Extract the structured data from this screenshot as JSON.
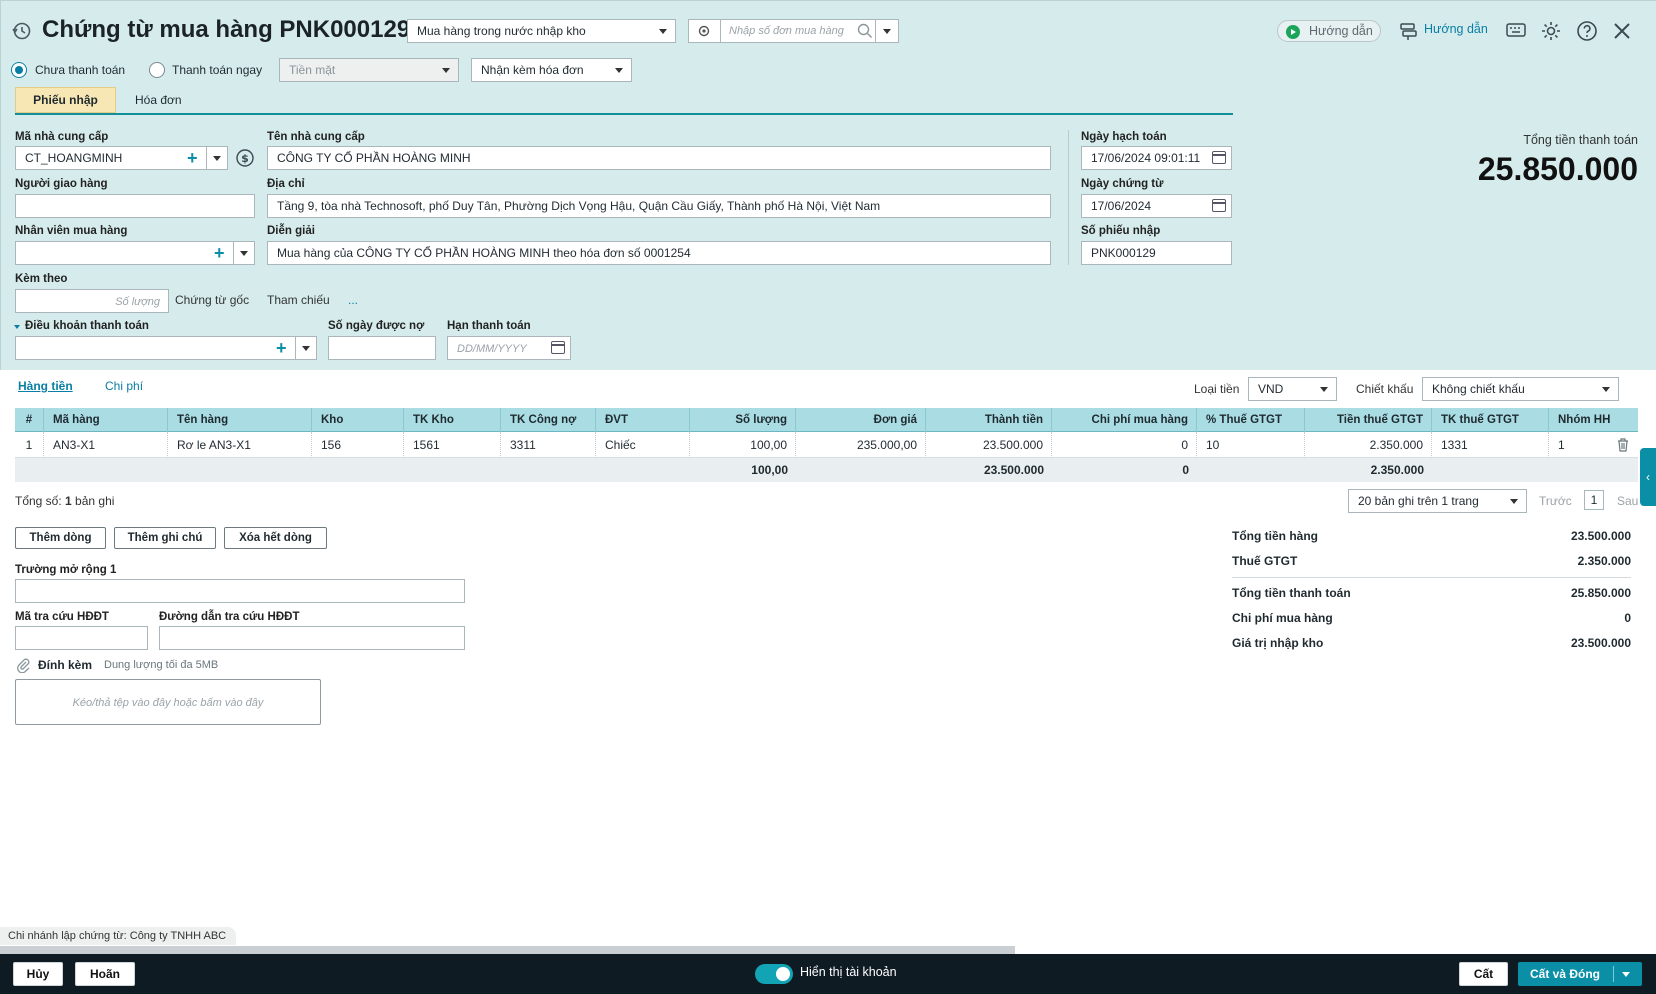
{
  "header": {
    "title": "Chứng từ mua hàng PNK000129",
    "voucher_type": "Mua hàng trong nước nhập kho",
    "order_search_placeholder": "Nhập số đơn mua hàng",
    "guide_button": "Hướng dẫn",
    "guide_link": "Hướng dẫn"
  },
  "payment": {
    "unpaid_label": "Chưa thanh toán",
    "paid_now_label": "Thanh toán ngay",
    "payment_method": "Tiền mặt",
    "invoice_option": "Nhận kèm hóa đơn"
  },
  "tabs": [
    "Phiếu nhập",
    "Hóa đơn"
  ],
  "form": {
    "supplier_code_label": "Mã nhà cung cấp",
    "supplier_code": "CT_HOANGMINH",
    "supplier_name_label": "Tên nhà cung cấp",
    "supplier_name": "CÔNG TY CỔ PHẦN HOÀNG MINH",
    "deliverer_label": "Người giao hàng",
    "deliverer": "",
    "address_label": "Địa chỉ",
    "address": "Tầng 9, tòa nhà Technosoft, phố Duy Tân, Phường Dịch Vọng Hậu, Quận Cầu Giấy, Thành phố Hà Nội, Việt Nam",
    "buyer_label": "Nhân viên mua hàng",
    "buyer": "",
    "description_label": "Diễn giải",
    "description": "Mua hàng của CÔNG TY CỔ PHẦN HOÀNG MINH theo hóa đơn số 0001254",
    "attach_label": "Kèm theo",
    "attach_qty_placeholder": "Số lượng",
    "original_docs": "Chứng từ gốc",
    "reference": "Tham chiếu",
    "more": "...",
    "payment_terms_label": "Điều khoản thanh toán",
    "credit_days_label": "Số ngày được nợ",
    "due_date_label": "Hạn thanh toán",
    "due_date_placeholder": "DD/MM/YYYY",
    "posting_date_label": "Ngày hạch toán",
    "posting_date": "17/06/2024 09:01:11",
    "doc_date_label": "Ngày chứng từ",
    "doc_date": "17/06/2024",
    "receipt_no_label": "Số phiếu nhập",
    "receipt_no": "PNK000129"
  },
  "total_box": {
    "label": "Tổng tiền thanh toán",
    "value": "25.850.000"
  },
  "detail_tabs": [
    "Hàng tiền",
    "Chi phí"
  ],
  "currency_label": "Loại tiền",
  "currency": "VND",
  "discount_label": "Chiết khấu",
  "discount": "Không chiết khấu",
  "grid": {
    "columns": [
      "#",
      "Mã hàng",
      "Tên hàng",
      "Kho",
      "TK Kho",
      "TK Công nợ",
      "ĐVT",
      "Số lượng",
      "Đơn giá",
      "Thành tiền",
      "Chi phí mua hàng",
      "% Thuế GTGT",
      "Tiền thuế GTGT",
      "TK thuế GTGT",
      "Nhóm HH"
    ],
    "rows": [
      [
        "1",
        "AN3-X1",
        "Rơ le AN3-X1",
        "156",
        "1561",
        "3311",
        "Chiếc",
        "100,00",
        "235.000,00",
        "23.500.000",
        "0",
        "10",
        "2.350.000",
        "1331",
        "1"
      ]
    ],
    "totals": {
      "quantity": "100,00",
      "amount": "23.500.000",
      "purchase_cost": "0",
      "vat": "2.350.000"
    }
  },
  "pagination": {
    "total_prefix": "Tổng số: ",
    "total_count": "1",
    "total_suffix": " bản ghi",
    "page_size": "20 bản ghi trên 1 trang",
    "prev": "Trước",
    "page": "1",
    "next": "Sau"
  },
  "row_actions": {
    "add_row": "Thêm dòng",
    "add_note": "Thêm ghi chú",
    "clear_rows": "Xóa hết dòng"
  },
  "extra": {
    "ext_field_label": "Trường mở rộng 1",
    "einv_code_label": "Mã tra cứu HĐĐT",
    "einv_url_label": "Đường dẫn tra cứu HĐĐT",
    "attachment_label": "Đính kèm",
    "attachment_hint": "Dung lượng tối đa 5MB",
    "dropzone_text": "Kéo/thả tệp vào đây hoặc bấm vào đây"
  },
  "summary": [
    {
      "label": "Tổng tiền hàng",
      "value": "23.500.000"
    },
    {
      "label": "Thuế GTGT",
      "value": "2.350.000"
    },
    {
      "label": "Tổng tiền thanh toán",
      "value": "25.850.000"
    },
    {
      "label": "Chi phí mua hàng",
      "value": "0"
    },
    {
      "label": "Giá trị nhập kho",
      "value": "23.500.000"
    }
  ],
  "branch_note": "Chi nhánh lập chứng từ: Công ty TNHH ABC",
  "footer": {
    "cancel": "Hủy",
    "undo": "Hoãn",
    "show_accounts": "Hiển thị tài khoản",
    "save": "Cất",
    "save_close": "Cất và Đóng"
  }
}
